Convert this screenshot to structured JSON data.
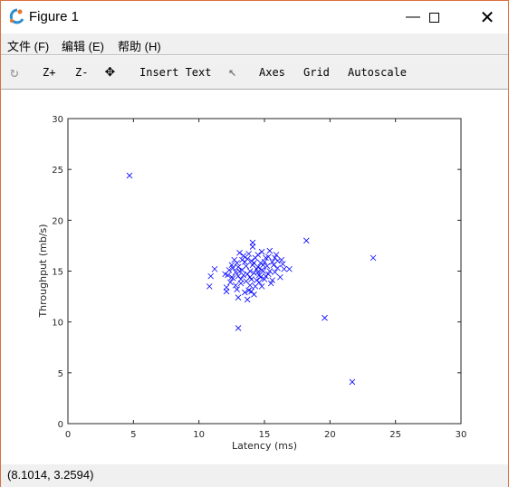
{
  "window": {
    "title": "Figure 1",
    "minimize_icon": "minimize-icon",
    "maximize_icon": "maximize-icon",
    "close_icon": "close-icon"
  },
  "menu": [
    {
      "label": "文件 (F)"
    },
    {
      "label": "编辑 (E)"
    },
    {
      "label": "帮助 (H)"
    }
  ],
  "toolbar": {
    "rotate_icon": "rotate-icon",
    "zoom_in": "Z+",
    "zoom_out": "Z-",
    "pan_icon": "pan-icon",
    "insert_text": "Insert Text",
    "select_icon": "pointer-icon",
    "axes": "Axes",
    "grid": "Grid",
    "autoscale": "Autoscale"
  },
  "status": {
    "coords": "(8.1014, 3.2594)"
  },
  "chart_data": {
    "type": "scatter",
    "xlabel": "Latency (ms)",
    "ylabel": "Throughput (mb/s)",
    "xlim": [
      0,
      30
    ],
    "ylim": [
      0,
      30
    ],
    "xticks": [
      "0",
      "5",
      "10",
      "15",
      "20",
      "25",
      "30"
    ],
    "yticks": [
      "0",
      "5",
      "10",
      "15",
      "20",
      "25",
      "30"
    ],
    "grid": false,
    "marker": "x",
    "color": "#0000ff",
    "points": [
      [
        4.7,
        24.4
      ],
      [
        18.2,
        18.0
      ],
      [
        23.3,
        16.3
      ],
      [
        19.6,
        10.4
      ],
      [
        21.7,
        4.1
      ],
      [
        13.0,
        9.4
      ],
      [
        10.9,
        14.5
      ],
      [
        11.2,
        15.2
      ],
      [
        10.8,
        13.5
      ],
      [
        12.0,
        14.7
      ],
      [
        12.1,
        13.0
      ],
      [
        13.0,
        15.4
      ],
      [
        13.4,
        14.6
      ],
      [
        14.2,
        15.8
      ],
      [
        14.8,
        15.1
      ],
      [
        13.7,
        16.2
      ],
      [
        15.3,
        14.7
      ],
      [
        12.8,
        14.9
      ],
      [
        14.0,
        14.2
      ],
      [
        15.6,
        15.9
      ],
      [
        13.2,
        13.8
      ],
      [
        14.5,
        16.6
      ],
      [
        12.5,
        15.6
      ],
      [
        16.0,
        15.3
      ],
      [
        13.9,
        15.0
      ],
      [
        14.3,
        13.5
      ],
      [
        15.1,
        16.3
      ],
      [
        12.6,
        14.3
      ],
      [
        13.5,
        15.9
      ],
      [
        14.7,
        14.4
      ],
      [
        15.8,
        14.9
      ],
      [
        13.1,
        16.8
      ],
      [
        14.1,
        17.4
      ],
      [
        12.9,
        13.2
      ],
      [
        16.3,
        16.1
      ],
      [
        15.5,
        13.8
      ],
      [
        13.6,
        14.0
      ],
      [
        14.9,
        15.6
      ],
      [
        12.3,
        15.1
      ],
      [
        14.4,
        15.2
      ],
      [
        13.8,
        13.1
      ],
      [
        15.2,
        15.5
      ],
      [
        16.5,
        15.2
      ],
      [
        12.7,
        16.1
      ],
      [
        14.6,
        13.9
      ],
      [
        13.3,
        15.1
      ],
      [
        15.0,
        14.2
      ],
      [
        14.0,
        16.0
      ],
      [
        13.0,
        14.5
      ],
      [
        15.9,
        16.6
      ],
      [
        12.4,
        13.9
      ],
      [
        14.8,
        16.9
      ],
      [
        13.7,
        14.7
      ],
      [
        15.4,
        15.0
      ],
      [
        14.2,
        14.8
      ],
      [
        13.4,
        16.5
      ],
      [
        16.2,
        14.4
      ],
      [
        12.2,
        14.6
      ],
      [
        14.5,
        15.4
      ],
      [
        13.9,
        13.6
      ],
      [
        15.7,
        15.6
      ],
      [
        12.9,
        15.8
      ],
      [
        14.3,
        16.3
      ],
      [
        13.5,
        12.9
      ],
      [
        15.1,
        14.5
      ],
      [
        14.7,
        15.8
      ],
      [
        13.2,
        14.2
      ],
      [
        16.0,
        16.0
      ],
      [
        14.1,
        15.6
      ],
      [
        12.6,
        15.3
      ],
      [
        13.8,
        16.7
      ],
      [
        15.3,
        16.4
      ],
      [
        14.4,
        14.1
      ],
      [
        13.6,
        15.5
      ],
      [
        15.6,
        14.1
      ],
      [
        12.8,
        13.6
      ],
      [
        14.9,
        15.0
      ],
      [
        14.0,
        13.0
      ],
      [
        13.1,
        15.0
      ],
      [
        15.0,
        15.9
      ],
      [
        16.4,
        15.7
      ],
      [
        14.6,
        14.6
      ],
      [
        13.3,
        16.1
      ],
      [
        14.2,
        12.7
      ],
      [
        15.8,
        16.3
      ],
      [
        12.5,
        14.4
      ],
      [
        13.0,
        12.4
      ],
      [
        13.7,
        12.2
      ],
      [
        14.8,
        13.5
      ],
      [
        16.9,
        15.2
      ],
      [
        14.1,
        17.8
      ],
      [
        12.1,
        13.4
      ],
      [
        15.4,
        17.0
      ],
      [
        13.9,
        14.4
      ],
      [
        14.5,
        14.9
      ]
    ]
  }
}
